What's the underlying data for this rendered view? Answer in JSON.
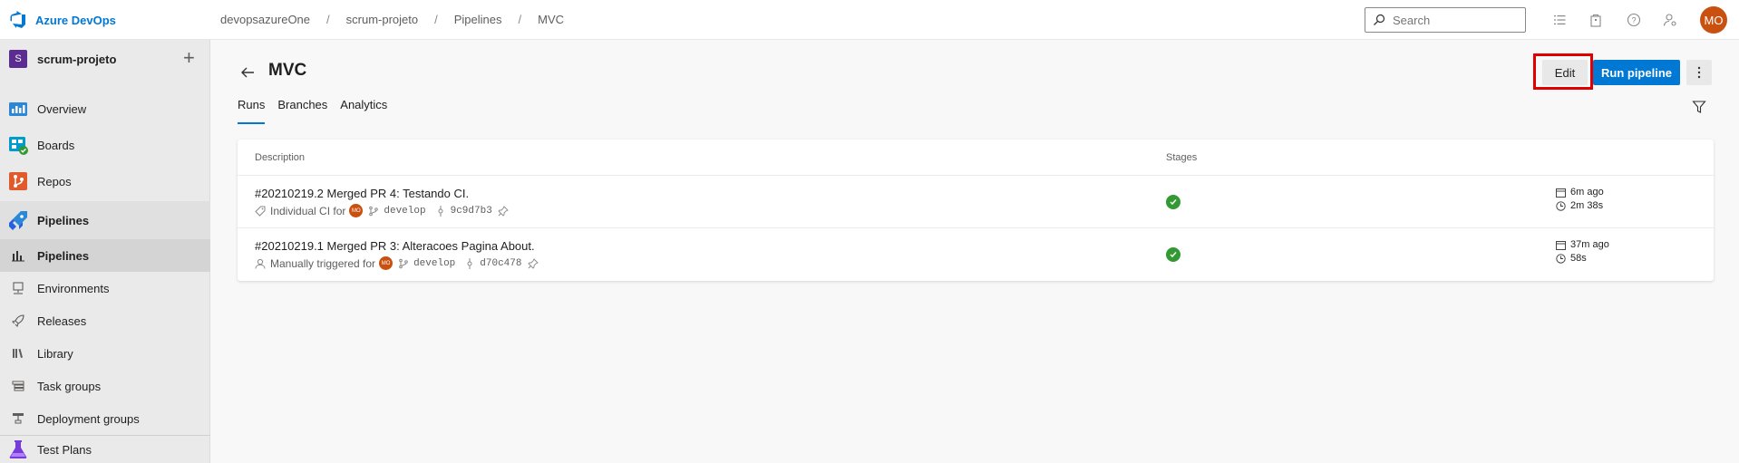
{
  "app": {
    "name": "Azure DevOps"
  },
  "breadcrumbs": [
    "devopsazureOne",
    "scrum-projeto",
    "Pipelines",
    "MVC"
  ],
  "search": {
    "placeholder": "Search"
  },
  "user": {
    "initials": "MO"
  },
  "sidebar": {
    "project_initial": "S",
    "project_name": "scrum-projeto",
    "items": [
      {
        "label": "Overview"
      },
      {
        "label": "Boards"
      },
      {
        "label": "Repos"
      },
      {
        "label": "Pipelines"
      }
    ],
    "sub_items": [
      {
        "label": "Pipelines"
      },
      {
        "label": "Environments"
      },
      {
        "label": "Releases"
      },
      {
        "label": "Library"
      },
      {
        "label": "Task groups"
      },
      {
        "label": "Deployment groups"
      }
    ],
    "bottom_item": {
      "label": "Test Plans"
    }
  },
  "page": {
    "title": "MVC",
    "tabs": [
      "Runs",
      "Branches",
      "Analytics"
    ],
    "edit_label": "Edit",
    "run_label": "Run pipeline"
  },
  "table": {
    "columns": [
      "Description",
      "Stages"
    ],
    "rows": [
      {
        "title": "#20210219.2 Merged PR 4: Testando CI.",
        "trigger": "Individual CI for",
        "avatar": "MO",
        "branch": "develop",
        "commit": "9c9d7b3",
        "ago": "6m ago",
        "duration": "2m 38s"
      },
      {
        "title": "#20210219.1 Merged PR 3: Alteracoes Pagina About.",
        "trigger": "Manually triggered for",
        "avatar": "MO",
        "branch": "develop",
        "commit": "d70c478",
        "ago": "37m ago",
        "duration": "58s"
      }
    ]
  },
  "colors": {
    "accent": "#0078d4",
    "success": "#339933",
    "avatar": "#ca5010",
    "project": "#5c2d91",
    "highlight": "#e00000"
  }
}
